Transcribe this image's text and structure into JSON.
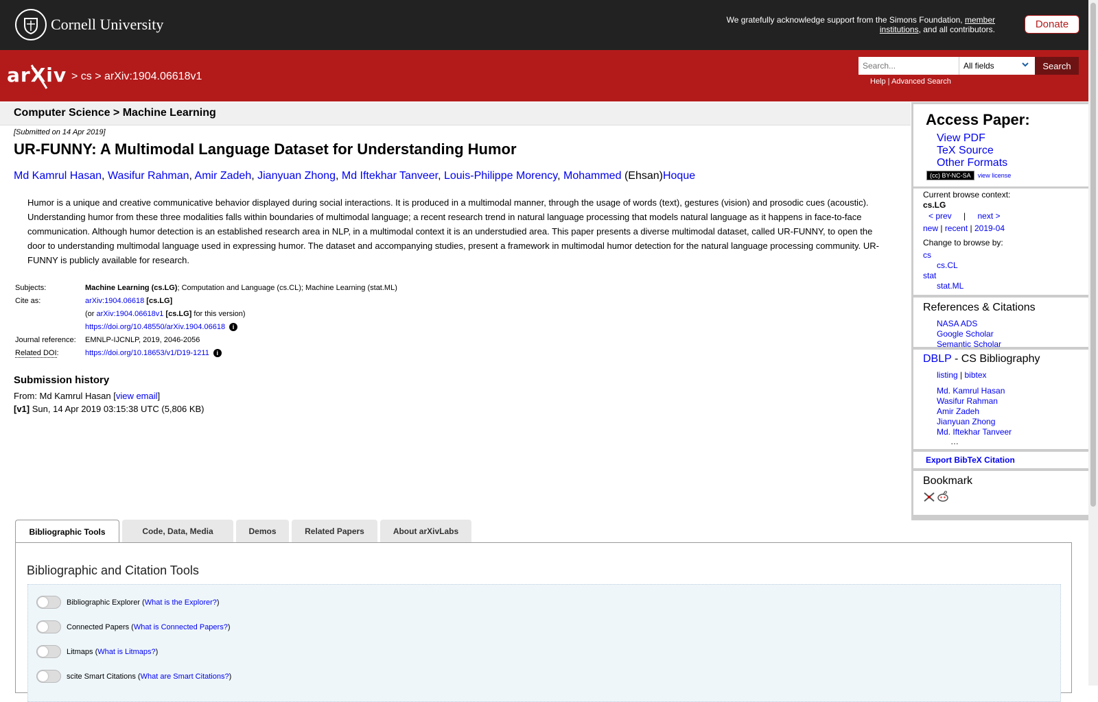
{
  "header": {
    "university": "Cornell University",
    "support_text": "We gratefully acknowledge support from the Simons Foundation,",
    "support_link": "member institutions",
    "support_tail": ", and all contributors.",
    "donate": "Donate"
  },
  "nav": {
    "logo": "arXiv",
    "crumb_sep1": " > ",
    "crumb_cs": "cs",
    "crumb_sep2": " > ",
    "crumb_id": "arXiv:1904.06618v1",
    "search_placeholder": "Search...",
    "field_select": "All fields",
    "search_button": "Search",
    "help": "Help",
    "advanced": "Advanced Search"
  },
  "subhead": "Computer Science > Machine Learning",
  "paper": {
    "submitted": "[Submitted on 14 Apr 2019]",
    "title": "UR-FUNNY: A Multimodal Language Dataset for Understanding Humor",
    "authors": [
      "Md Kamrul Hasan",
      "Wasifur Rahman",
      "Amir Zadeh",
      "Jianyuan Zhong",
      "Md Iftekhar Tanveer",
      "Louis-Philippe Morency",
      "Mohammed"
    ],
    "author_ehsan": "(Ehsan)",
    "author_last": "Hoque",
    "abstract": "Humor is a unique and creative communicative behavior displayed during social interactions. It is produced in a multimodal manner, through the usage of words (text), gestures (vision) and prosodic cues (acoustic). Understanding humor from these three modalities falls within boundaries of multimodal language; a recent research trend in natural language processing that models natural language as it happens in face-to-face communication. Although humor detection is an established research area in NLP, in a multimodal context it is an understudied area. This paper presents a diverse multimodal dataset, called UR-FUNNY, to open the door to understanding multimodal language used in expressing humor. The dataset and accompanying studies, present a framework in multimodal humor detection for the natural language processing community. UR-FUNNY is publicly available for research."
  },
  "meta": {
    "subjects_label": "Subjects:",
    "subjects_primary": "Machine Learning (cs.LG)",
    "subjects_rest": "; Computation and Language (cs.CL); Machine Learning (stat.ML)",
    "cite_label": "Cite as:",
    "cite_id": "arXiv:1904.06618",
    "cite_cat": "[cs.LG]",
    "or_prefix": "(or ",
    "or_id": "arXiv:1904.06618v1",
    "or_cat": "[cs.LG]",
    "or_suffix": " for this version)",
    "doi": "https://doi.org/10.48550/arXiv.1904.06618",
    "journal_label": "Journal reference:",
    "journal": "EMNLP-IJCNLP, 2019, 2046-2056",
    "related_label": "Related DOI",
    "related_colon": ":",
    "related_doi": "https://doi.org/10.18653/v1/D19-1211"
  },
  "history": {
    "title": "Submission history",
    "from_prefix": "From: Md Kamrul Hasan [",
    "view_email": "view email",
    "from_suffix": "]",
    "v1_tag": "[v1]",
    "v1_text": " Sun, 14 Apr 2019 03:15:38 UTC (5,806 KB)"
  },
  "sidebar": {
    "access_title": "Access Paper:",
    "access_links": [
      "View PDF",
      "TeX Source",
      "Other Formats"
    ],
    "license_badge": "(cc) BY-NC-SA",
    "view_license": "view license",
    "context_label": "Current browse context:",
    "context": "cs.LG",
    "prev": "< prev",
    "sep": "|",
    "next": "next >",
    "new": "new",
    "recent": "recent",
    "month": "2019-04",
    "change_label": "Change to browse by:",
    "cs": "cs",
    "cscl": "cs.CL",
    "stat": "stat",
    "statml": "stat.ML",
    "refs_title": "References & Citations",
    "refs": [
      "NASA ADS",
      "Google Scholar",
      "Semantic Scholar"
    ],
    "dblp": "DBLP",
    "dblp_rest": " - CS Bibliography",
    "listing": "listing",
    "bibtex": "bibtex",
    "dblp_authors": [
      "Md. Kamrul Hasan",
      "Wasifur Rahman",
      "Amir Zadeh",
      "Jianyuan Zhong",
      "Md. Iftekhar Tanveer"
    ],
    "ellipsis": "…",
    "export": "Export BibTeX Citation",
    "bookmark": "Bookmark"
  },
  "tabs": [
    "Bibliographic Tools",
    "Code, Data, Media",
    "Demos",
    "Related Papers",
    "About arXivLabs"
  ],
  "panel": {
    "title": "Bibliographic and Citation Tools",
    "tools": [
      {
        "name": "Bibliographic Explorer",
        "link": "What is the Explorer?"
      },
      {
        "name": "Connected Papers",
        "link": "What is Connected Papers?"
      },
      {
        "name": "Litmaps",
        "link": "What is Litmaps?"
      },
      {
        "name": "scite Smart Citations",
        "link": "What are Smart Citations?"
      }
    ]
  },
  "colors": {
    "arxiv_red": "#b31b1b",
    "topbar": "#222222",
    "link": "#0000ee"
  }
}
